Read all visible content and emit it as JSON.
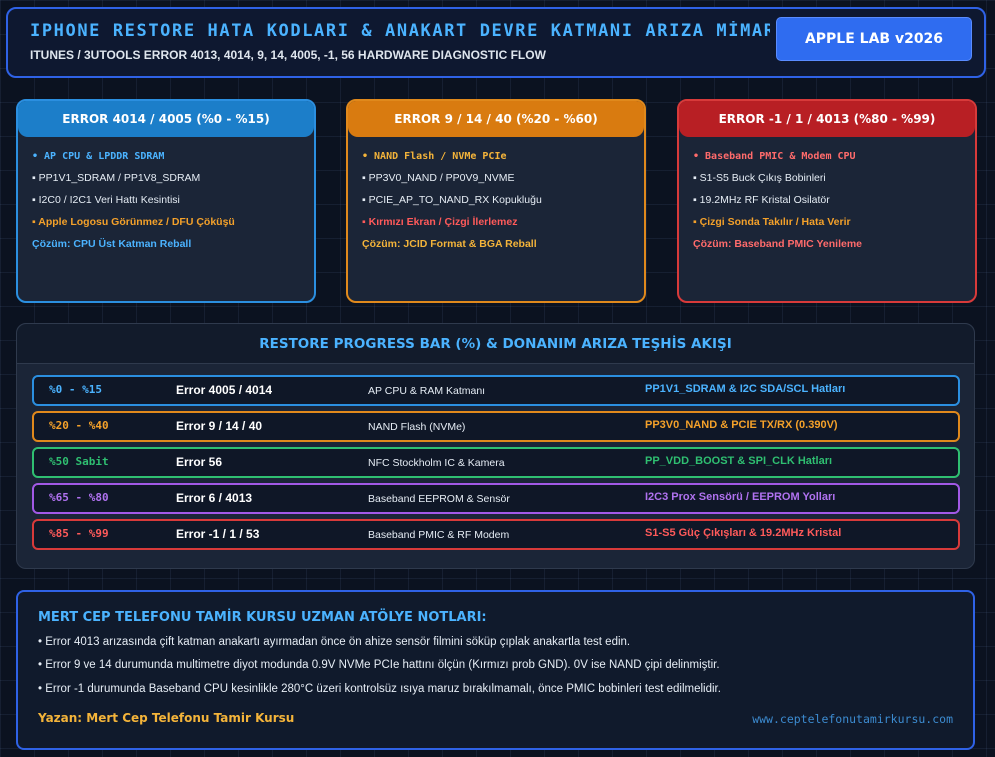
{
  "header": {
    "title": "IPHONE RESTORE HATA KODLARI & ANAKART DEVRE KATMANI ARIZA MİMARİSİ",
    "subtitle": "ITUNES / 3UTOOLS ERROR 4013, 4014, 9, 14, 4005, -1, 56 HARDWARE DIAGNOSTIC FLOW",
    "badge": "APPLE LAB v2026"
  },
  "cards": [
    {
      "title": "ERROR 4014 / 4005 (%0 - %15)",
      "chip": "• AP CPU & LPDDR SDRAM",
      "lines": [
        "▪ PP1V1_SDRAM / PP1V8_SDRAM",
        "▪ I2C0 / I2C1 Veri Hattı Kesintisi"
      ],
      "warning": "▪ Apple Logosu Görünmez / DFU Çöküşü",
      "solution": "Çözüm: CPU Üst Katman Reball"
    },
    {
      "title": "ERROR 9 / 14 / 40 (%20 - %60)",
      "chip": "• NAND Flash / NVMe PCIe",
      "lines": [
        "▪ PP3V0_NAND / PP0V9_NVME",
        "▪ PCIE_AP_TO_NAND_RX Kopukluğu"
      ],
      "warning": "▪ Kırmızı Ekran / Çizgi İlerlemez",
      "solution": "Çözüm: JCID Format & BGA Reball"
    },
    {
      "title": "ERROR -1 / 1 / 4013 (%80 - %99)",
      "chip": "• Baseband PMIC & Modem CPU",
      "lines": [
        "▪ S1-S5 Buck Çıkış Bobinleri",
        "▪ 19.2MHz RF Kristal Osilatör"
      ],
      "warning": "▪ Çizgi Sonda Takılır / Hata Verir",
      "solution": "Çözüm: Baseband PMIC Yenileme"
    }
  ],
  "progress": {
    "title": "RESTORE PROGRESS BAR (%) & DONANIM ARIZA TEŞHİS AKIŞI",
    "rows": [
      {
        "range": "%0 - %15",
        "error": "Error 4005 / 4014",
        "component": "AP CPU & RAM Katmanı",
        "hint": "PP1V1_SDRAM & I2C SDA/SCL Hatları"
      },
      {
        "range": "%20 - %40",
        "error": "Error 9 / 14 / 40",
        "component": "NAND Flash (NVMe)",
        "hint": "PP3V0_NAND & PCIE TX/RX (0.390V)"
      },
      {
        "range": "%50 Sabit",
        "error": "Error 56",
        "component": "NFC Stockholm IC & Kamera",
        "hint": "PP_VDD_BOOST & SPI_CLK Hatları"
      },
      {
        "range": "%65 - %80",
        "error": "Error 6 / 4013",
        "component": "Baseband EEPROM & Sensör",
        "hint": "I2C3 Prox Sensörü / EEPROM Yolları"
      },
      {
        "range": "%85 - %99",
        "error": "Error -1 / 1 / 53",
        "component": "Baseband PMIC & RF Modem",
        "hint": "S1-S5 Güç Çıkışları & 19.2MHz Kristal"
      }
    ]
  },
  "notes": {
    "title": "MERT CEP TELEFONU TAMİR KURSU UZMAN ATÖLYE NOTLARI:",
    "items": [
      "• Error 4013 arızasında çift katman anakartı ayırmadan önce ön ahize sensör filmini söküp çıplak anakartla test edin.",
      "• Error 9 ve 14 durumunda multimetre diyot modunda 0.9V NVMe PCIe hattını ölçün (Kırmızı prob GND). 0V ise NAND çipi delinmiştir.",
      "• Error -1 durumunda Baseband CPU kesinlikle 280°C üzeri kontrolsüz ısıya maruz bırakılmamalı, önce PMIC bobinleri test edilmelidir."
    ],
    "author": "Yazan: Mert Cep Telefonu Tamir Kursu",
    "url": "www.ceptelefonutamirkursu.com"
  },
  "colors": {
    "accent_blue": "#4bb3ff",
    "blue": "#2b8fe0",
    "orange": "#e0891c",
    "green": "#2fbf71",
    "purple": "#a259e6",
    "red": "#e0444a",
    "amber": "#f4b43a"
  }
}
